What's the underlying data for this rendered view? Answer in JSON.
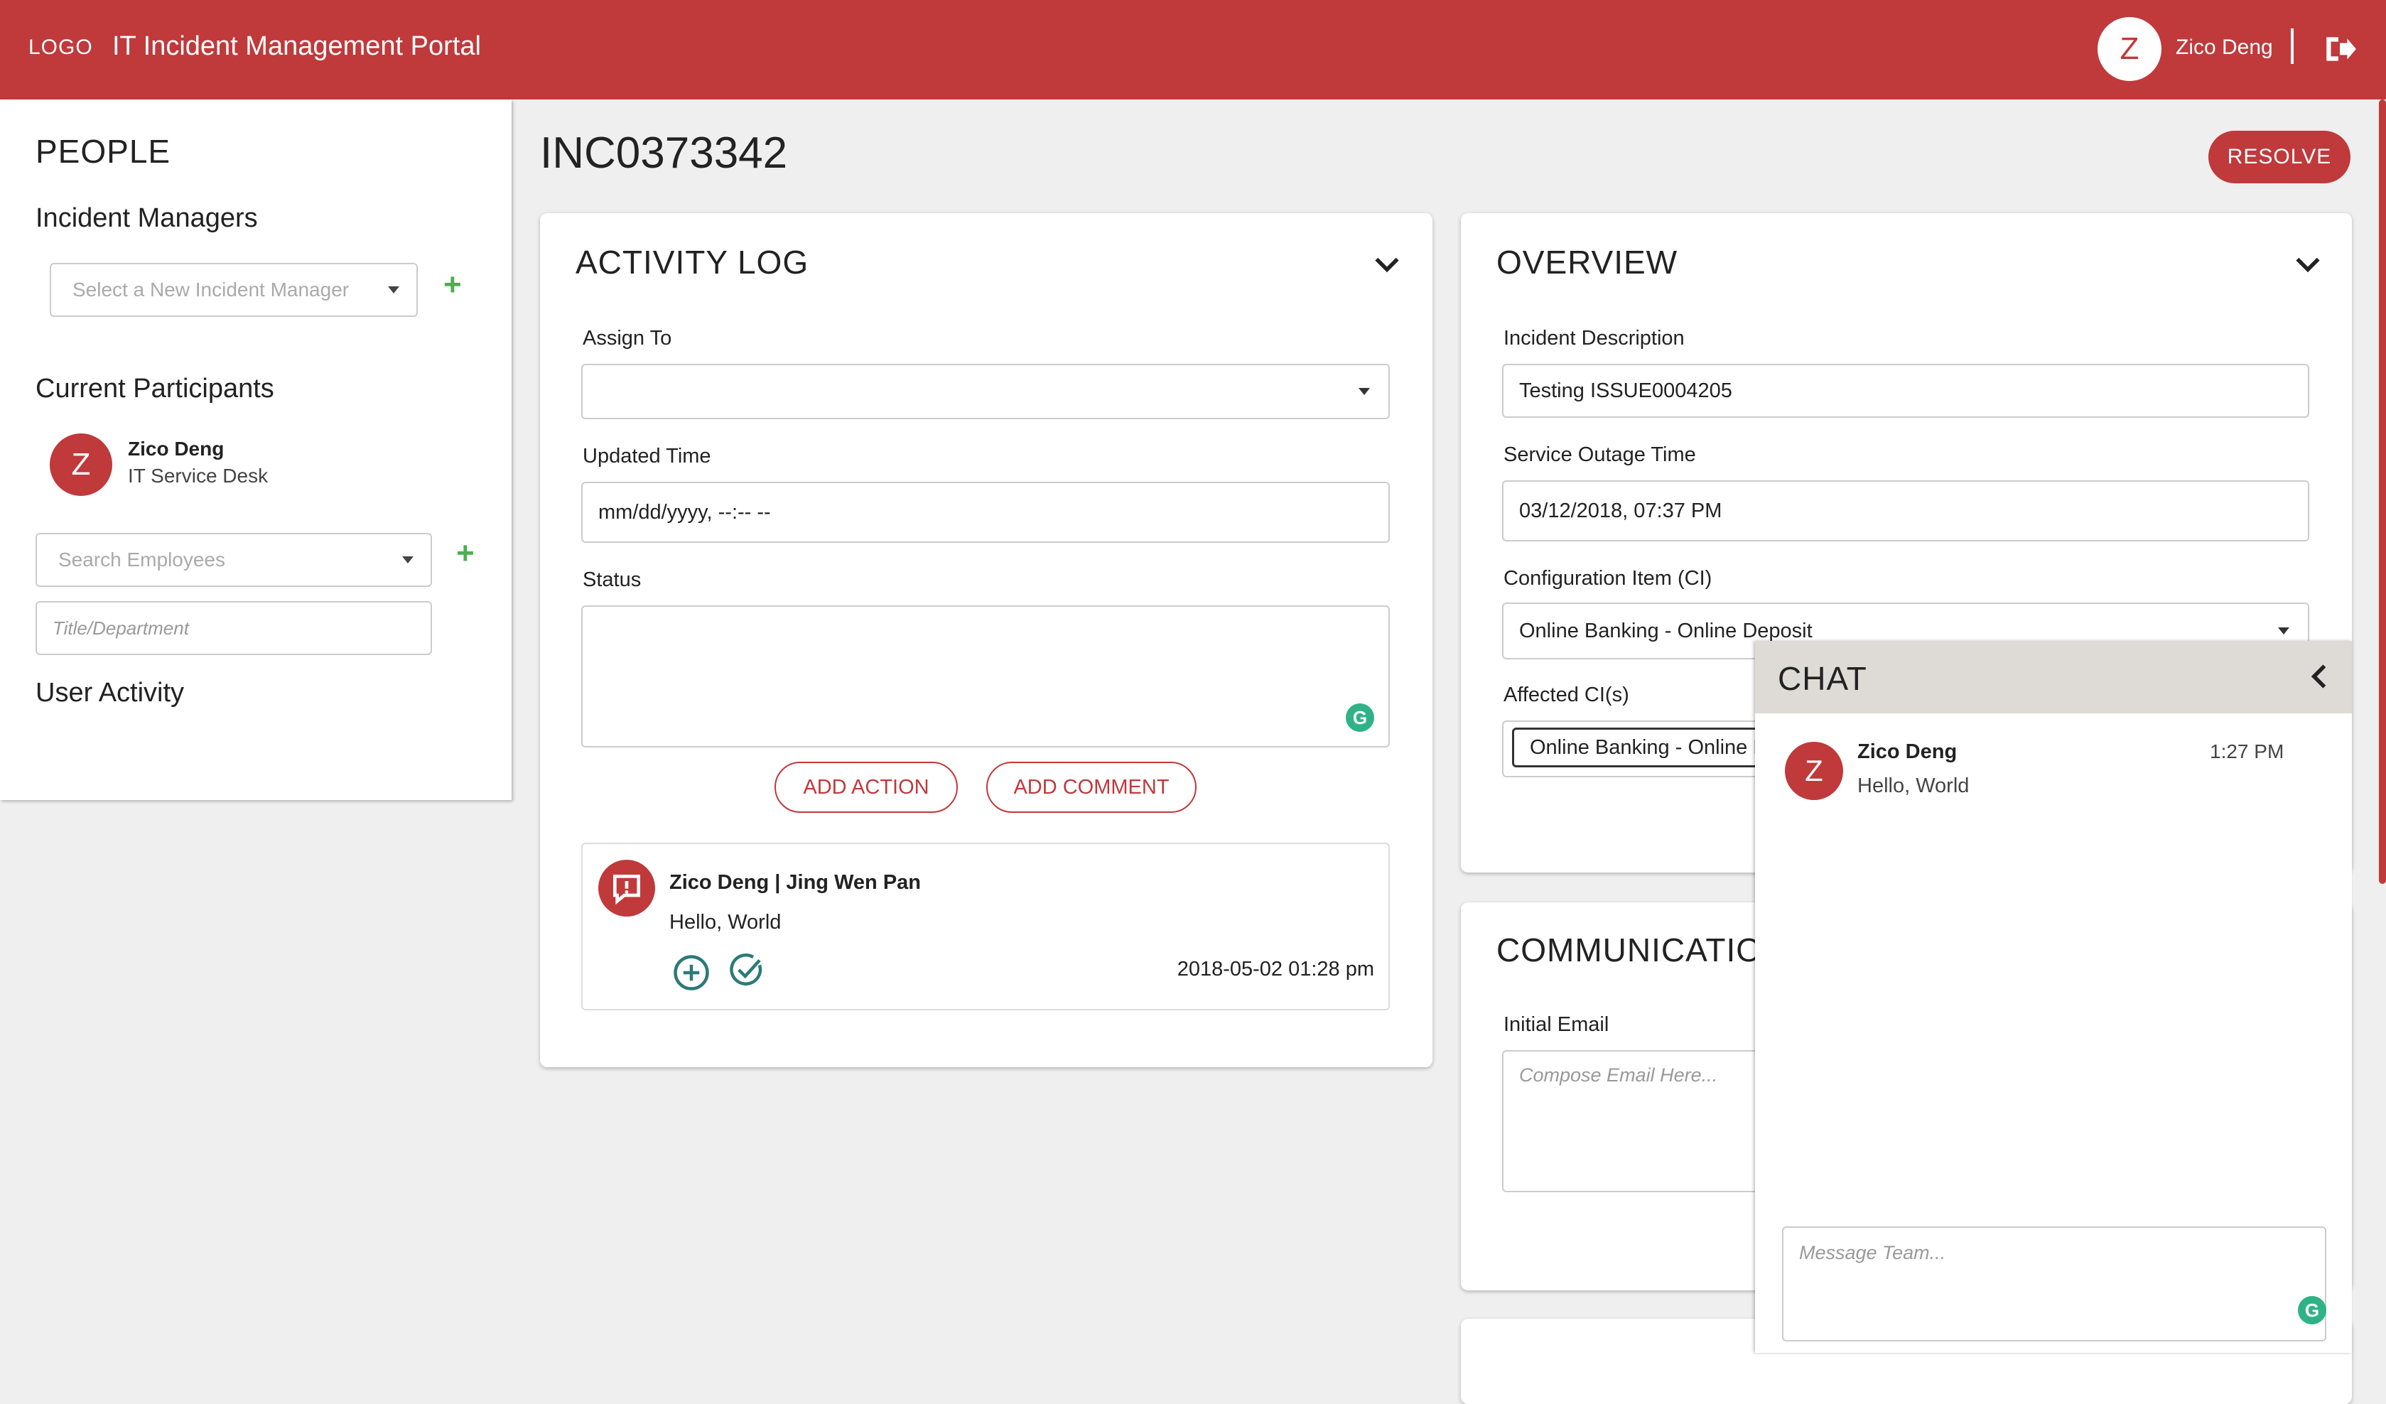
{
  "header": {
    "logo": "LOGO",
    "title": "IT Incident Management Portal",
    "user_initial": "Z",
    "user_name": "Zico Deng",
    "logout_icon": "sign-out-icon"
  },
  "sidebar": {
    "heading": "PEOPLE",
    "incident_managers_label": "Incident Managers",
    "manager_select_placeholder": "Select a New Incident Manager",
    "participants_label": "Current Participants",
    "participants": [
      {
        "initial": "Z",
        "name": "Zico Deng",
        "role": "IT Service Desk"
      }
    ],
    "search_placeholder": "Search Employees",
    "title_placeholder": "Title/Department",
    "user_activity_label": "User Activity"
  },
  "incident": {
    "id": "INC0373342",
    "resolve_label": "RESOLVE"
  },
  "activity_log": {
    "title": "ACTIVITY LOG",
    "assign_to_label": "Assign To",
    "assign_to_value": "",
    "updated_time_label": "Updated Time",
    "updated_time_value": "mm/dd/yyyy, --:-- --",
    "status_label": "Status",
    "status_value": "",
    "add_action_label": "ADD ACTION",
    "add_comment_label": "ADD COMMENT",
    "entries": [
      {
        "authors": "Zico Deng  |  Jing Wen Pan",
        "message": "Hello, World",
        "timestamp": "2018-05-02 01:28 pm"
      }
    ]
  },
  "overview": {
    "title": "OVERVIEW",
    "description_label": "Incident Description",
    "description_value": "Testing ISSUE0004205",
    "outage_label": "Service Outage Time",
    "outage_value": "03/12/2018, 07:37  PM",
    "ci_label": "Configuration Item (CI)",
    "ci_value": "Online Banking - Online Deposit",
    "affected_label": "Affected CI(s)",
    "affected_chip": "Online Banking - Online Deposit"
  },
  "communication": {
    "title": "COMMUNICATION",
    "initial_email_label": "Initial Email",
    "email_placeholder": "Compose Email Here..."
  },
  "chat": {
    "title": "CHAT",
    "messages": [
      {
        "initial": "Z",
        "name": "Zico Deng",
        "time": "1:27 PM",
        "text": "Hello, World"
      }
    ],
    "input_placeholder": "Message Team..."
  },
  "colors": {
    "brand": "#c0393b",
    "success": "#4caf50",
    "grammarly": "#2fb386",
    "teal_icon": "#2b7a78"
  }
}
